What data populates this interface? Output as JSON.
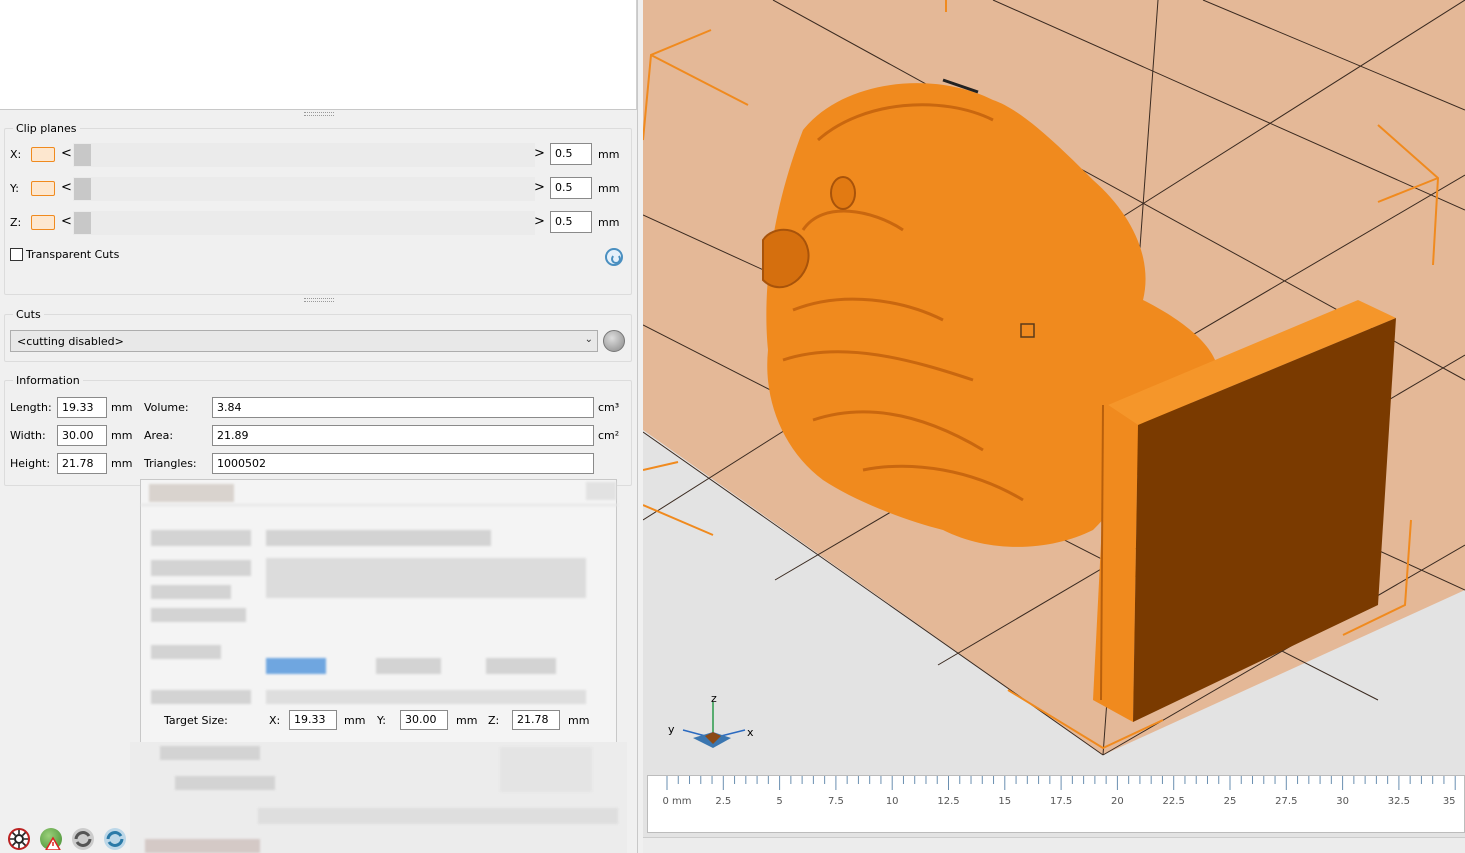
{
  "clip_planes": {
    "title": "Clip planes",
    "rows": [
      {
        "axis": "X:",
        "value": "0.5",
        "unit": "mm"
      },
      {
        "axis": "Y:",
        "value": "0.5",
        "unit": "mm"
      },
      {
        "axis": "Z:",
        "value": "0.5",
        "unit": "mm"
      }
    ],
    "arrow_left": "<",
    "arrow_right": ">",
    "transparent_cuts_label": "Transparent Cuts",
    "transparent_cuts_checked": false
  },
  "cuts": {
    "title": "Cuts",
    "selected": "<cutting disabled>"
  },
  "information": {
    "title": "Information",
    "length_label": "Length:",
    "length_value": "19.33",
    "length_unit": "mm",
    "width_label": "Width:",
    "width_value": "30.00",
    "width_unit": "mm",
    "height_label": "Height:",
    "height_value": "21.78",
    "height_unit": "mm",
    "volume_label": "Volume:",
    "volume_value": "3.84",
    "volume_unit": "cm³",
    "area_label": "Area:",
    "area_value": "21.89",
    "area_unit": "cm²",
    "triangles_label": "Triangles:",
    "triangles_value": "1000502"
  },
  "target_size": {
    "label": "Target Size:",
    "x_label": "X:",
    "x_value": "19.33",
    "x_unit": "mm",
    "y_label": "Y:",
    "y_value": "30.00",
    "y_unit": "mm",
    "z_label": "Z:",
    "z_value": "21.78",
    "z_unit": "mm"
  },
  "axis_gizmo": {
    "x": "x",
    "y": "y",
    "z": "z"
  },
  "ruler": {
    "labels": [
      "0 mm",
      "2.5",
      "5",
      "7.5",
      "10",
      "12.5",
      "15",
      "17.5",
      "20",
      "22.5",
      "25",
      "27.5",
      "30",
      "32.5",
      "35"
    ]
  },
  "colors": {
    "model_orange": "#f08a1e",
    "plate_tan": "#e4b897",
    "accent_blue": "#4a8fc0"
  },
  "icons": [
    "settings-gear-icon",
    "globe-warning-icon",
    "rotate-icon",
    "rotate-blue-icon",
    "reset-icon",
    "knife-sphere-icon"
  ]
}
